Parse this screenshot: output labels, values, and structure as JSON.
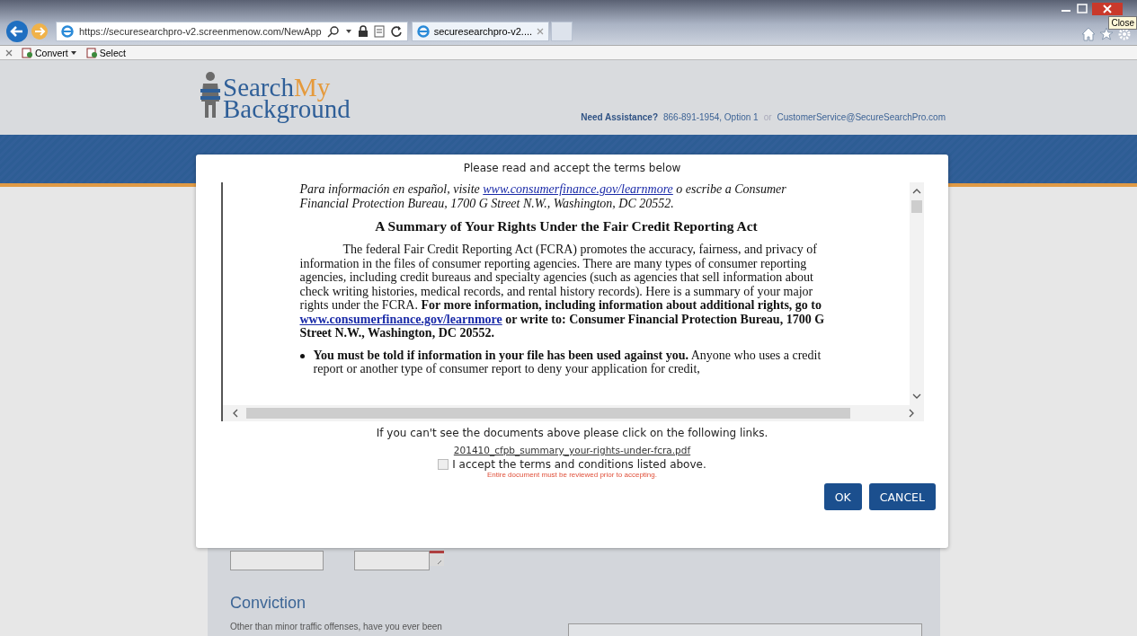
{
  "browser": {
    "address": "https://securesearchpro-v2.screenmenow.com/NewApp",
    "tab_title": "securesearchpro-v2....",
    "command_bar": [
      {
        "label": "Convert",
        "kind": "dropdown"
      },
      {
        "label": "Select",
        "kind": "plain"
      }
    ],
    "tooltip": "Close"
  },
  "header": {
    "logo": {
      "first": "Search",
      "accent": "My",
      "second": "Background"
    },
    "assistance": {
      "label": "Need Assistance?",
      "phone": "866-891-1954, Option 1",
      "separator": "or",
      "email": "CustomerService@SecureSearchPro.com"
    }
  },
  "form": {
    "section_title": "Conviction",
    "question": "Other than minor traffic offenses, have you ever been"
  },
  "modal": {
    "title": "Please read and accept the terms below",
    "document": {
      "intro": {
        "before": "Para información en español, visite",
        "link": "www.consumerfinance.gov/learnmore",
        "after": "o escribe a Consumer Financial Protection Bureau, 1700 G Street N.W., Washington, DC 20552."
      },
      "heading": "A Summary of Your Rights Under the Fair Credit Reporting Act",
      "paragraph": {
        "text": "The federal Fair Credit Reporting Act (FCRA) promotes the accuracy, fairness, and privacy of information in the files of consumer reporting agencies. There are many types of consumer reporting agencies, including credit bureaus and specialty agencies (such as agencies that sell information about check writing histories, medical records, and rental history records). Here is a summary of your major rights under the FCRA.",
        "bold_before": "For more information, including information about additional rights, go to",
        "link": "www.consumerfinance.gov/learnmore",
        "bold_after": "or write to: Consumer Financial Protection Bureau, 1700 G Street N.W., Washington, DC 20552."
      },
      "bullet": {
        "lead": "You must be told if information in your file has been used against you.",
        "text": "Anyone who uses a credit report or another type of consumer report to deny your application for credit,"
      }
    },
    "note": "If you can't see the documents above please click on the following links.",
    "file_link": "201410_cfpb_summary_your-rights-under-fcra.pdf",
    "accept": {
      "label": "I accept the terms and conditions listed above.",
      "checked": false
    },
    "warning": "Entire document must be reviewed prior to accepting.",
    "buttons": [
      {
        "label": "OK"
      },
      {
        "label": "CANCEL"
      }
    ]
  }
}
